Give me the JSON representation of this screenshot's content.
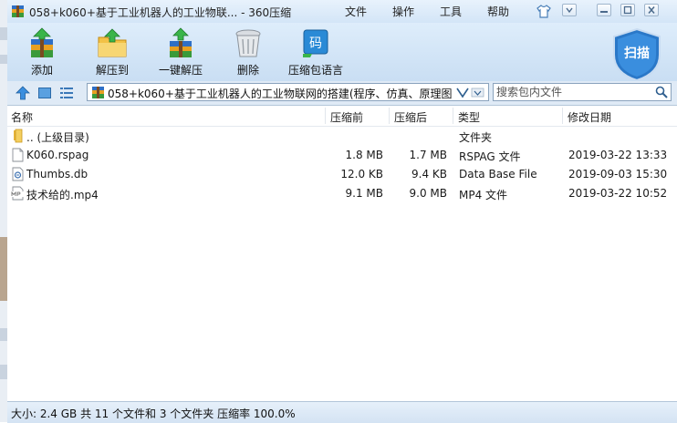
{
  "window": {
    "title": "058+k060+基于工业机器人的工业物联... - 360压缩"
  },
  "menu": [
    "文件",
    "操作",
    "工具",
    "帮助"
  ],
  "toolbar": {
    "add": "添加",
    "extract_to": "解压到",
    "one_click_extract": "一键解压",
    "delete": "删除",
    "archive_language": "压缩包语言",
    "scan": "扫描"
  },
  "address": {
    "path": "058+k060+基于工业机器人的工业物联网的搭建(程序、仿真、原理图 )"
  },
  "search": {
    "placeholder": "搜索包内文件"
  },
  "columns": {
    "name": "名称",
    "compressed": "压缩前",
    "uncompressed": "压缩后",
    "type": "类型",
    "modified": "修改日期"
  },
  "rows": [
    {
      "name": ".. (上级目录)",
      "compressed": "",
      "uncompressed": "",
      "type": "文件夹",
      "modified": "",
      "icon": "folder-icon"
    },
    {
      "name": "K060.rspag",
      "compressed": "1.8 MB",
      "uncompressed": "1.7 MB",
      "type": "RSPAG 文件",
      "modified": "2019-03-22 13:33",
      "icon": "file-icon"
    },
    {
      "name": "Thumbs.db",
      "compressed": "12.0 KB",
      "uncompressed": "9.4 KB",
      "type": "Data Base File",
      "modified": "2019-09-03 15:30",
      "icon": "db-file-icon"
    },
    {
      "name": "技术给的.mp4",
      "compressed": "9.1 MB",
      "uncompressed": "9.0 MB",
      "type": "MP4 文件",
      "modified": "2019-03-22 10:52",
      "icon": "video-file-icon"
    }
  ],
  "status": {
    "text": "大小: 2.4 GB 共 11 个文件和 3 个文件夹 压缩率 100.0%"
  },
  "colors": {
    "titlebar": "#dbe9f8",
    "toolbar": "#cfe2f5",
    "accent": "#2a78c8"
  }
}
